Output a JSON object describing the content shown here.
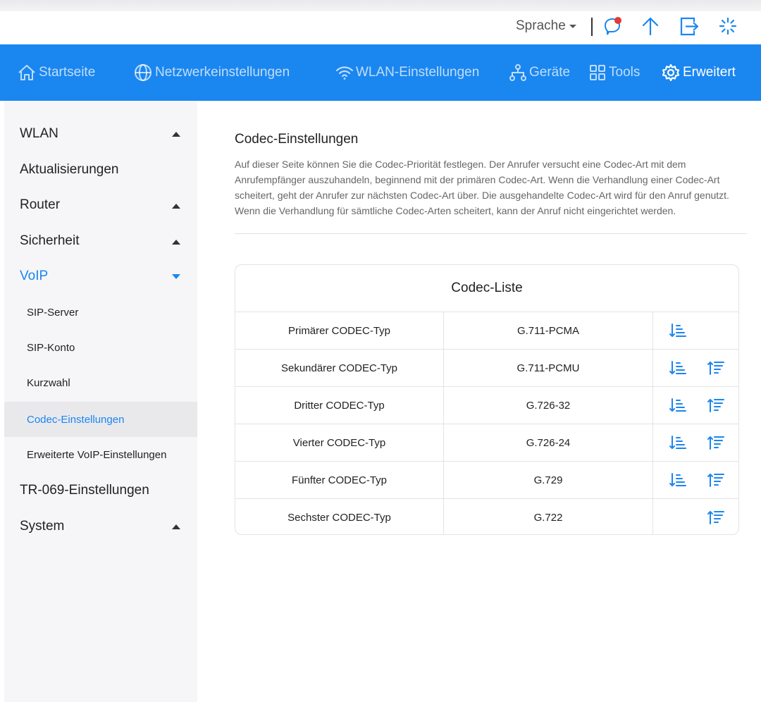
{
  "topbar": {
    "language_label": "Sprache",
    "icons": [
      "chat-notification-icon",
      "upload-arrow-icon",
      "logout-icon",
      "loading-spinner-icon"
    ],
    "notification_dot_color": "#e53935"
  },
  "nav": {
    "items": [
      {
        "label": "Startseite",
        "icon": "home-icon"
      },
      {
        "label": "Netzwerkeinstellungen",
        "icon": "globe-icon"
      },
      {
        "label": "WLAN-Einstellungen",
        "icon": "wifi-icon"
      },
      {
        "label": "Geräte",
        "icon": "devices-icon"
      },
      {
        "label": "Tools",
        "icon": "tools-icon"
      },
      {
        "label": "Erweitert",
        "icon": "gear-icon",
        "active": true
      }
    ],
    "accent_color": "#1a86f0"
  },
  "sidebar": {
    "items": [
      {
        "label": "WLAN",
        "expandable": true
      },
      {
        "label": "Aktualisierungen"
      },
      {
        "label": "Router",
        "expandable": true
      },
      {
        "label": "Sicherheit",
        "expandable": true
      },
      {
        "label": "VoIP",
        "expandable": true,
        "open": true
      },
      {
        "label": "SIP-Server",
        "sub": true
      },
      {
        "label": "SIP-Konto",
        "sub": true
      },
      {
        "label": "Kurzwahl",
        "sub": true
      },
      {
        "label": "Codec-Einstellungen",
        "sub": true,
        "selected": true
      },
      {
        "label": "Erweiterte VoIP-Einstellungen",
        "sub": true
      },
      {
        "label": "TR-069-Einstellungen"
      },
      {
        "label": "System",
        "expandable": true
      }
    ]
  },
  "main": {
    "title": "Codec-Einstellungen",
    "description": "Auf dieser Seite können Sie die Codec-Priorität festlegen. Der Anrufer versucht eine Codec-Art mit dem Anrufempfänger auszuhandeln, beginnend mit der primären Codec-Art. Wenn die Verhandlung einer Codec-Art scheitert, geht der Anrufer zur nächsten Codec-Art über. Die ausgehandelte Codec-Art wird für den Anruf genutzt. Wenn die Verhandlung für sämtliche Codec-Arten scheitert, kann der Anruf nicht eingerichtet werden.",
    "codec_list": {
      "title": "Codec-Liste",
      "rows": [
        {
          "type": "Primärer CODEC-Typ",
          "codec": "G.711-PCMA",
          "move_down": true,
          "move_up": false
        },
        {
          "type": "Sekundärer CODEC-Typ",
          "codec": "G.711-PCMU",
          "move_down": true,
          "move_up": true
        },
        {
          "type": "Dritter CODEC-Typ",
          "codec": "G.726-32",
          "move_down": true,
          "move_up": true
        },
        {
          "type": "Vierter CODEC-Typ",
          "codec": "G.726-24",
          "move_down": true,
          "move_up": true
        },
        {
          "type": "Fünfter CODEC-Typ",
          "codec": "G.729",
          "move_down": true,
          "move_up": true
        },
        {
          "type": "Sechster CODEC-Typ",
          "codec": "G.722",
          "move_down": false,
          "move_up": true
        }
      ]
    }
  }
}
